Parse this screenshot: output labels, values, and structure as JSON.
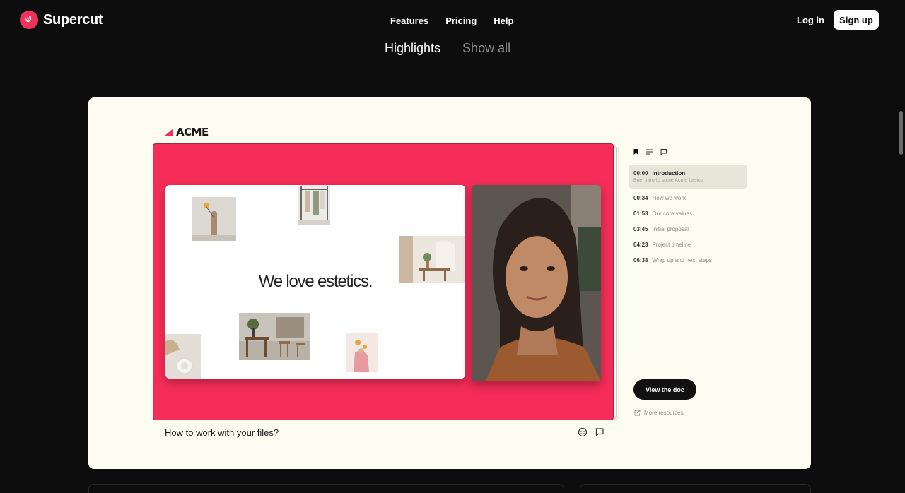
{
  "brand": {
    "name": "Supercut",
    "accent": "#f0315c"
  },
  "nav": {
    "links": [
      "Features",
      "Pricing",
      "Help"
    ],
    "login": "Log in",
    "signup": "Sign up"
  },
  "tabs": [
    {
      "label": "Highlights",
      "active": true
    },
    {
      "label": "Show all",
      "active": false
    }
  ],
  "card": {
    "logo": "ACME",
    "slide_title": "We love estetics.",
    "caption": "How to work with your files?",
    "video_bg": "#f62d58",
    "chapters": [
      {
        "time": "00:00",
        "label": "Introduction",
        "desc": "Brief intro to some Acme basics",
        "active": true
      },
      {
        "time": "00:34",
        "label": "How we work"
      },
      {
        "time": "01:53",
        "label": "Our core values"
      },
      {
        "time": "03:45",
        "label": "Initial proposal"
      },
      {
        "time": "04:23",
        "label": "Project timeline"
      },
      {
        "time": "06:38",
        "label": "Wrap up and next steps"
      }
    ],
    "view_doc": "View the doc",
    "more_resources": "More resources"
  }
}
